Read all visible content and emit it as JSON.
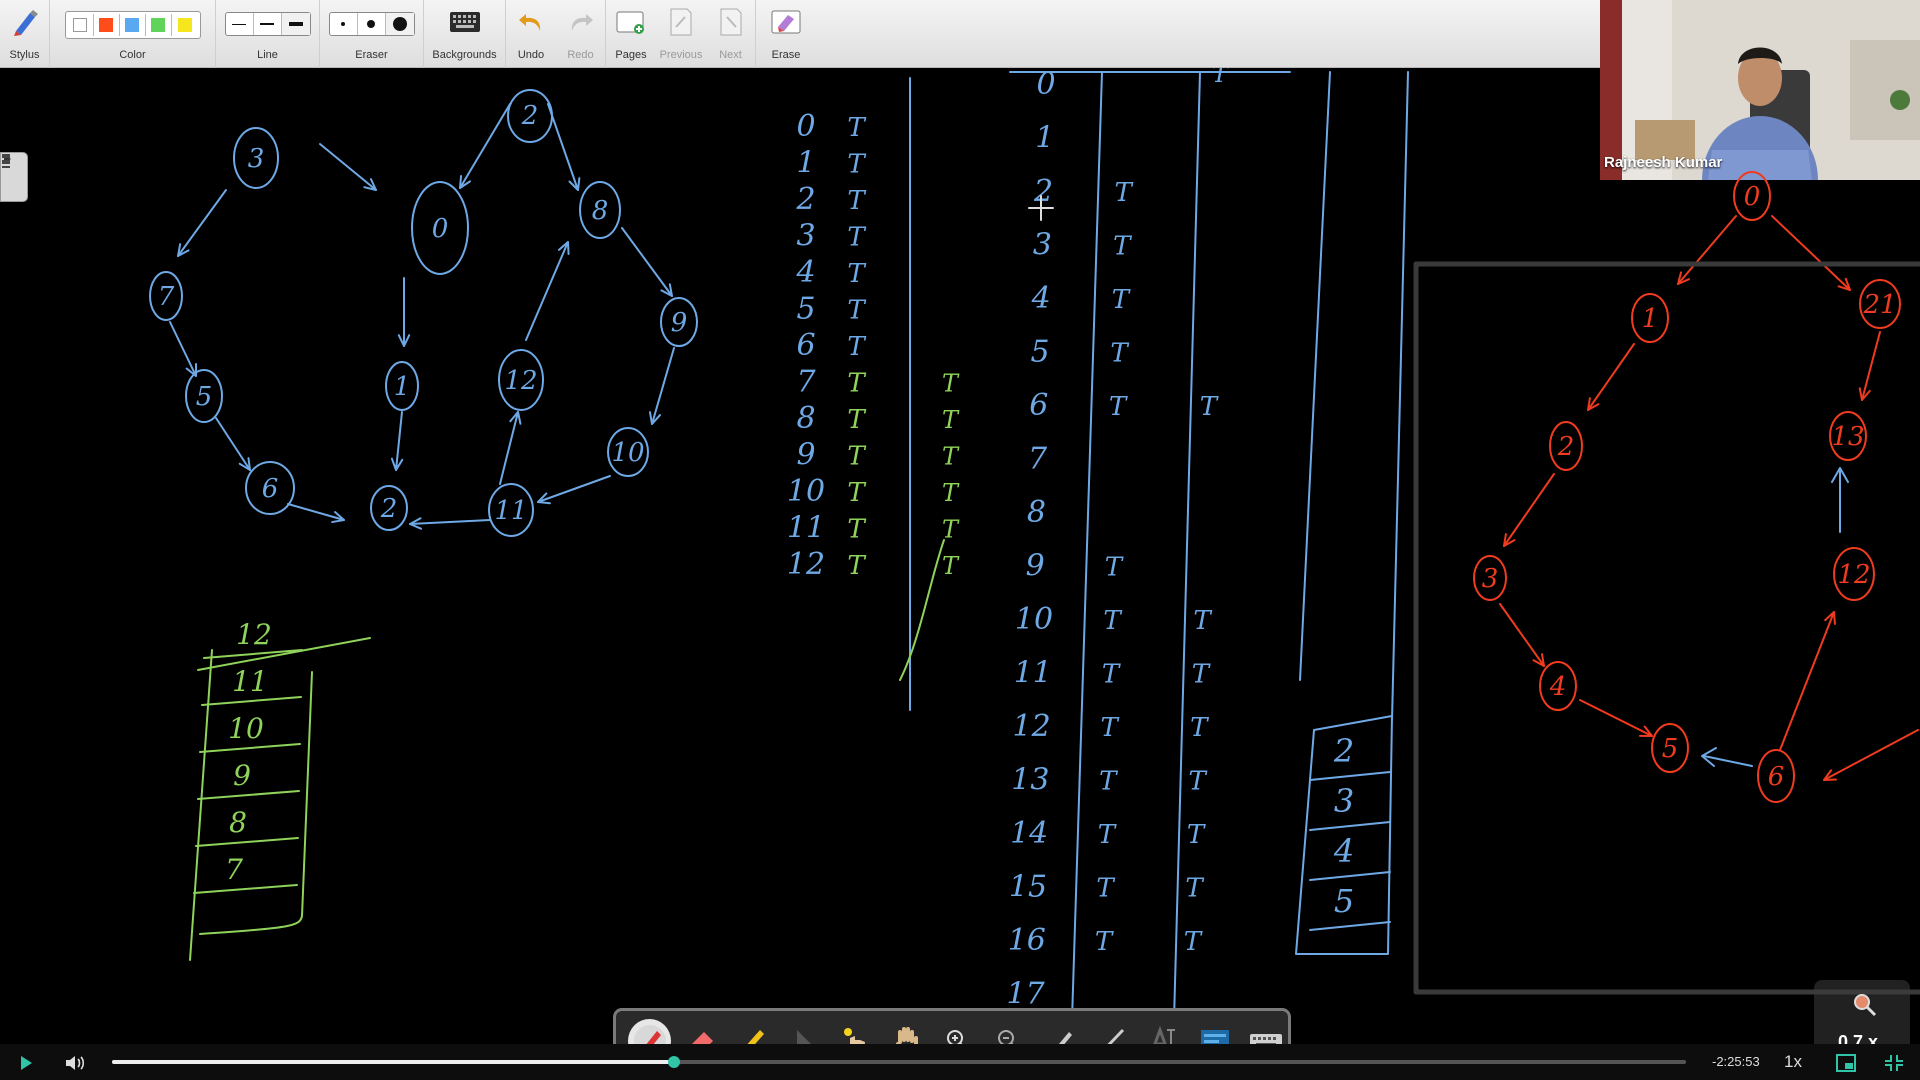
{
  "toolbar": {
    "stylus_label": "Stylus",
    "color_label": "Color",
    "line_label": "Line",
    "eraser_label": "Eraser",
    "backgrounds_label": "Backgrounds",
    "undo_label": "Undo",
    "redo_label": "Redo",
    "pages_label": "Pages",
    "previous_label": "Previous",
    "next_label": "Next",
    "erase_label": "Erase",
    "colors": [
      "#ffffff",
      "#ff4d1a",
      "#5aa9f0",
      "#5fd35a",
      "#f5e61e"
    ]
  },
  "webcam": {
    "presenter_name": "Rajneesh Kumar"
  },
  "whiteboard": {
    "ink_colors": {
      "blue": "#6ea9e6",
      "green": "#8fd35a",
      "red": "#ef3b1f"
    },
    "blue_graph_nodes": [
      "3",
      "0",
      "7",
      "8",
      "1",
      "5",
      "12",
      "9",
      "6",
      "2",
      "11",
      "10"
    ],
    "red_graph_nodes": [
      "0",
      "1",
      "2",
      "3",
      "4",
      "5",
      "6",
      "12",
      "13",
      "21"
    ],
    "table1": {
      "rows": [
        [
          "0",
          "T",
          ""
        ],
        [
          "1",
          "T",
          ""
        ],
        [
          "2",
          "T",
          ""
        ],
        [
          "3",
          "T",
          ""
        ],
        [
          "4",
          "T",
          ""
        ],
        [
          "5",
          "T",
          ""
        ],
        [
          "6",
          "T",
          ""
        ],
        [
          "7",
          "T",
          "T"
        ],
        [
          "8",
          "T",
          "T"
        ],
        [
          "9",
          "T",
          "T"
        ],
        [
          "10",
          "T",
          "T"
        ],
        [
          "11",
          "T",
          "T"
        ],
        [
          "12",
          "T",
          "T"
        ]
      ]
    },
    "table2": {
      "rows": [
        [
          "0",
          "",
          ""
        ],
        [
          "1",
          "",
          ""
        ],
        [
          "2",
          "T",
          ""
        ],
        [
          "3",
          "T",
          ""
        ],
        [
          "4",
          "T",
          ""
        ],
        [
          "5",
          "T",
          ""
        ],
        [
          "6",
          "T",
          "T"
        ],
        [
          "7",
          "",
          ""
        ],
        [
          "8",
          "",
          ""
        ],
        [
          "9",
          "T",
          ""
        ],
        [
          "10",
          "T",
          "T"
        ],
        [
          "11",
          "T",
          "T"
        ],
        [
          "12",
          "T",
          "T"
        ],
        [
          "13",
          "T",
          "T"
        ],
        [
          "14",
          "T",
          "T"
        ],
        [
          "15",
          "T",
          "T"
        ],
        [
          "16",
          "T",
          "T"
        ],
        [
          "17",
          "",
          ""
        ]
      ]
    },
    "green_stack": [
      "12",
      "11",
      "10",
      "9",
      "8",
      "7"
    ],
    "blue_stack": [
      "2",
      "3",
      "4",
      "5"
    ]
  },
  "player": {
    "time_remaining": "-2:25:53",
    "speed": "1x",
    "zoom": "0.7 x",
    "progress": 0.357
  }
}
